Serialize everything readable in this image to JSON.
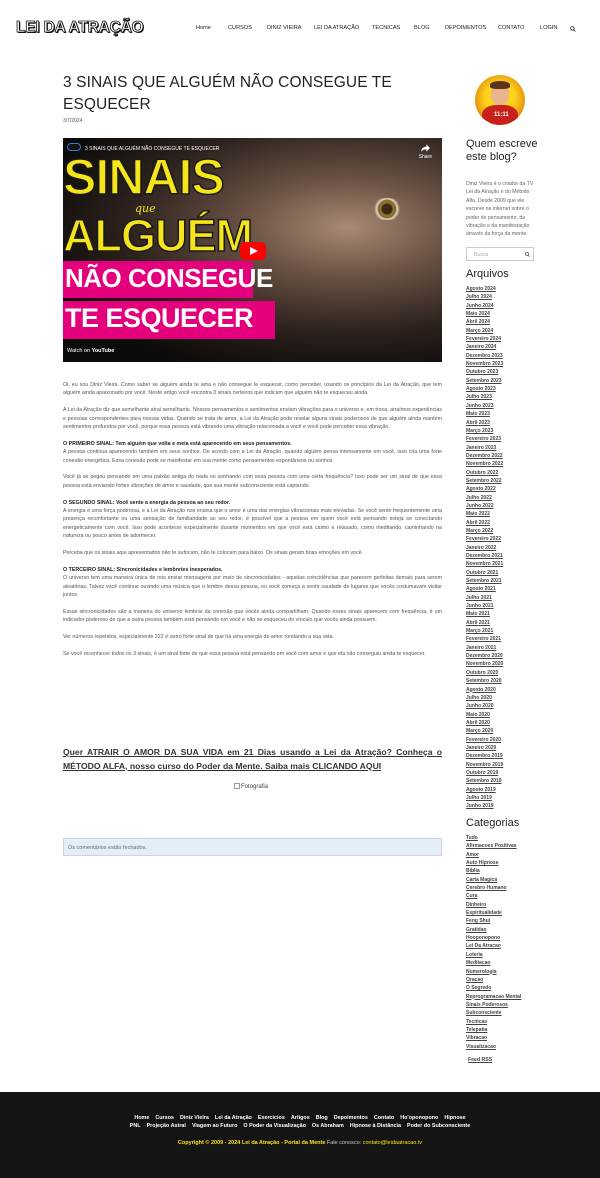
{
  "header": {
    "logo": "LEI DA ATRAÇÃO",
    "nav": [
      "Home",
      "CURSOS",
      "DINIZ VIEIRA",
      "LEI DA ATRAÇÃO",
      "TECNICAS",
      "BLOG",
      "DEPOIMENTOS",
      "CONTATO",
      "LOGIN"
    ],
    "search_icon": "search-icon"
  },
  "post": {
    "title": "3 SINAIS QUE ALGUÉM NÃO CONSEGUE TE ESQUECER",
    "date": "3/7/2024",
    "video": {
      "title": "3 SINAIS QUE ALGUÉM NÃO CONSEGUE TE ESQUECER",
      "share": "Share",
      "line1": "SINAIS",
      "que": "que",
      "line2": "ALGUÉM",
      "line3": "NÃO CONSEGUE",
      "line4": "TE ESQUECER",
      "watch_on": "Watch on",
      "youtube": "YouTube"
    },
    "paragraphs": [
      {
        "lead": "",
        "text": "Oi, eu sou Diniz Vieira. Como saber se alguém ainda te ama e não consegue te esquecer, como perceber, usando os princípios da Lei da Atração, que tem alguém ainda apaixonado por você. Neste artigo você encontra 3 sinais certeiros que indicam que alguém não te esqueceu ainda."
      },
      {
        "lead": "",
        "text": "A Lei da Atração diz que semelhante atrai semelhante. Nossos pensamentos e sentimentos enviam vibrações para o universo e, em troca, atraímos experiências e pessoas correspondentes para nossas vidas. Quando se trata de amor, a Lei da Atração pode revelar alguns sinais poderosos de que alguém ainda mantém sentimentos profundos por você, porque essa pessoa está vibrando uma vibração relacionada a você e você pode perceber essa vibração."
      },
      {
        "lead": "O PRIMEIRO SINAL: Tem alguém que volta e meia está aparecendo em seus pensamentos.",
        "text": "A pessoa continua aparecendo também em seus sonhos. De acordo com a Lei da Atração, quando alguém pensa intensamente em você, isso cria uma forte conexão energética. Essa conexão pode se manifestar em sua mente como pensamentos espontâneos ou sonhos."
      },
      {
        "lead": "",
        "text": "Você já se pegou pensando em uma paixão antiga do nada ou sonhando com essa pessoa com uma certa frequência? Isso pode ser um sinal de que essa pessoa está enviando fortes vibrações de amor e saudade, que sua mente subconsciente está captando."
      },
      {
        "lead": "O SEGUNDO SINAL: Você sente a energia da pessoa ao seu redor.",
        "text": "A energia é uma força poderosa, e a Lei da Atração nos ensina que o amor é uma das energias vibracionais mais elevadas. Se você sente frequentemente uma presença reconfortante ou uma sensação de familiaridade ao seu redor, é possível que a pessoa em quem você está pensando esteja se conectando energeticamente com você. Isso pode acontecer especialmente durante momentos em que você está calmo e relaxado, como meditando, caminhando na natureza ou pouco antes de adormecer."
      },
      {
        "lead": "",
        "text": "Perceba que os sinais aqui apresentados não te sufocam, não te colocam para baixo. Os sinais geram boas emoções em você."
      },
      {
        "lead": "O TERCEIRO SINAL: Sincronicidades e lembretes inesperados.",
        "text": "O universo tem uma maneira única de nos enviar mensagens por meio de sincronicidades - aquelas coincidências que parecem perfeitas demais para serem aleatórias. Talvez você continue ouvindo uma música que o lembre dessa pessoa, ou você começa a sentir saudade de lugares que vocês costumavam visitar juntos."
      },
      {
        "lead": "",
        "text": "Essas sincronicidades são a maneira do universo lembrar da conexão que vocês ainda compartilham. Quando esses sinais aparecem com frequência, é um indicador poderoso de que a outra pessoa também está pensando em você e não se esqueceu do vínculo que vocês ainda possuem."
      },
      {
        "lead": "",
        "text": "Ver números repetidos, especialmente 222 é outro forte sinal de que há uma energia de amor rondando a sua vida."
      },
      {
        "lead": "",
        "text": "Se você reconhecer todos os 3 sinais, é um sinal forte de que essa pessoa está pensando em você com amor e que ela não conseguiu ainda te esquecer."
      }
    ],
    "cta": "Quer ATRAIR O AMOR DA SUA VIDA em 21 Dias usando a Lei da Atração? Conheça o MÉTODO ALFA, nosso curso do Poder da Mente. Saiba mais CLICANDO AQUI",
    "photo_alt": "Fotografia",
    "comments_closed": "Os comentários estão fechados."
  },
  "sidebar": {
    "avatar_text": "11:11",
    "about_title": "Quem escreve este blog?",
    "about_text": "Diniz Vieira é o criador da TV Lei da Atração e do Método Alfa. Desde 2009 que ele escreve na internet sobre o poder do pensamento, da vibração e da manifestação através da força da mente.",
    "search_placeholder": "Busca",
    "archives_title": "Arquivos",
    "archives": [
      "Agosto 2024",
      "Julho 2024",
      "Junho 2024",
      "Maio 2024",
      "Abril 2024",
      "Março 2024",
      "Fevereiro 2024",
      "Janeiro 2024",
      "Dezembro 2023",
      "Novembro 2023",
      "Outubro 2023",
      "Setembro 2023",
      "Agosto 2023",
      "Julho 2023",
      "Junho 2023",
      "Maio 2023",
      "Abril 2023",
      "Março 2023",
      "Fevereiro 2023",
      "Janeiro 2023",
      "Dezembro 2022",
      "Novembro 2022",
      "Outubro 2022",
      "Setembro 2022",
      "Agosto 2022",
      "Julho 2022",
      "Junho 2022",
      "Maio 2022",
      "Abril 2022",
      "Março 2022",
      "Fevereiro 2022",
      "Janeiro 2022",
      "Dezembro 2021",
      "Novembro 2021",
      "Outubro 2021",
      "Setembro 2021",
      "Agosto 2021",
      "Julho 2021",
      "Junho 2021",
      "Maio 2021",
      "Abril 2021",
      "Março 2021",
      "Fevereiro 2021",
      "Janeiro 2021",
      "Dezembro 2020",
      "Novembro 2020",
      "Outubro 2020",
      "Setembro 2020",
      "Agosto 2020",
      "Julho 2020",
      "Junho 2020",
      "Maio 2020",
      "Abril 2020",
      "Março 2020",
      "Fevereiro 2020",
      "Janeiro 2020",
      "Dezembro 2019",
      "Novembro 2019",
      "Outubro 2019",
      "Setembro 2019",
      "Agosto 2019",
      "Julho 2019",
      "Junho 2019"
    ],
    "categories_title": "Categorias",
    "categories": [
      "Tudo",
      "Afirmacoes Positivas",
      "Amor",
      "Auto Hipnose",
      "Biblia",
      "Carta Magica",
      "Cerebro Humano",
      "Cura",
      "Dinheiro",
      "Espiritualidade",
      "Feng Shui",
      "Gratidao",
      "Hooponopono",
      "Lei Da Atracao",
      "Loteria",
      "Meditacao",
      "Numerologia",
      "Oracao",
      "O Segredo",
      "Reprogramacao Mental",
      "Sinais Poderosos",
      "Subconsciente",
      "Tecnicas",
      "Telepatia",
      "Vibracao",
      "Visualizacao"
    ],
    "feed": "Feed RSS"
  },
  "footer": {
    "row1": [
      "Home",
      "Cursos",
      "Diniz Vieira",
      "Lei da Atração",
      "Exercícios",
      "Artigos",
      "Blog",
      "Depoimentos",
      "Contato",
      "Ho'oponopono",
      "Hipnose"
    ],
    "row2": [
      "PNL",
      "Projeção Astral",
      "Viagem ao Futuro",
      "O Poder da Visualização",
      "Os Abraham",
      "Hipnose à Distância",
      "Poder do Subconsciente"
    ],
    "copyright": "Copyright © 2009 - 2024 Lei da Atração - Portal da Mente",
    "contact_label": "Fale conosco:",
    "contact_email": "contato@leidaatracao.tv"
  }
}
